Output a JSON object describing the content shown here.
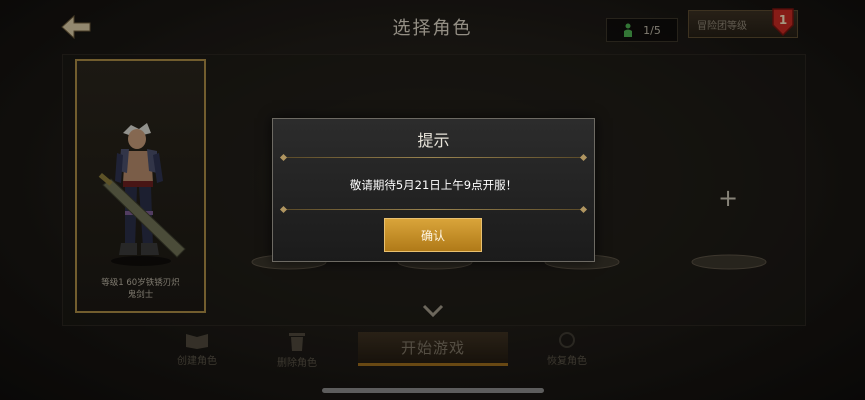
{
  "header": {
    "title": "选择角色",
    "slot_count": "1/5",
    "level_button_label": "冒险团等级",
    "level_badge": "1"
  },
  "character": {
    "caption_line1": "等级1 60岁铁锈刃炽",
    "caption_line2": "鬼剑士"
  },
  "slots": {
    "add_symbol": "+"
  },
  "bottom_bar": {
    "create_label": "创建角色",
    "delete_label": "删除角色",
    "start_label": "开始游戏",
    "other_label": "恢复角色"
  },
  "dialog": {
    "title": "提示",
    "message": "敬请期待5月21日上午9点开服！",
    "confirm_label": "确认"
  },
  "colors": {
    "accent_gold": "#c89030",
    "card_border": "#a88a44",
    "badge_red": "#c62a22"
  }
}
